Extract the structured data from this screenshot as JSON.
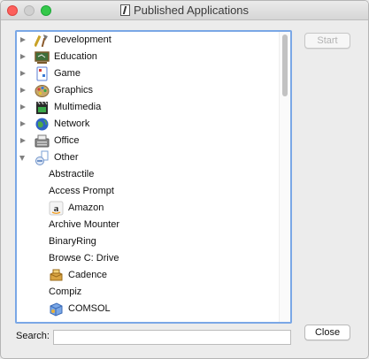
{
  "window": {
    "title": "Published Applications"
  },
  "tree": {
    "categories": [
      {
        "label": "Development",
        "icon": "development-icon",
        "expanded": false
      },
      {
        "label": "Education",
        "icon": "education-icon",
        "expanded": false
      },
      {
        "label": "Game",
        "icon": "game-icon",
        "expanded": false
      },
      {
        "label": "Graphics",
        "icon": "graphics-icon",
        "expanded": false
      },
      {
        "label": "Multimedia",
        "icon": "multimedia-icon",
        "expanded": false
      },
      {
        "label": "Network",
        "icon": "network-icon",
        "expanded": false
      },
      {
        "label": "Office",
        "icon": "office-icon",
        "expanded": false
      },
      {
        "label": "Other",
        "icon": "other-icon",
        "expanded": true
      }
    ],
    "other_apps": [
      {
        "label": "Abstractile",
        "icon": ""
      },
      {
        "label": "Access Prompt",
        "icon": ""
      },
      {
        "label": "Amazon",
        "icon": "amazon-icon"
      },
      {
        "label": "Archive Mounter",
        "icon": ""
      },
      {
        "label": "BinaryRing",
        "icon": ""
      },
      {
        "label": "Browse C: Drive",
        "icon": ""
      },
      {
        "label": "Cadence",
        "icon": "cadence-icon"
      },
      {
        "label": "Compiz",
        "icon": ""
      },
      {
        "label": "COMSOL",
        "icon": "comsol-icon"
      }
    ]
  },
  "buttons": {
    "start_label": "Start",
    "close_label": "Close"
  },
  "search": {
    "label": "Search:",
    "value": "",
    "placeholder": ""
  },
  "colors": {
    "focus_ring": "#7aa7e6",
    "close": "#fc605c",
    "maximize": "#34c84a"
  }
}
